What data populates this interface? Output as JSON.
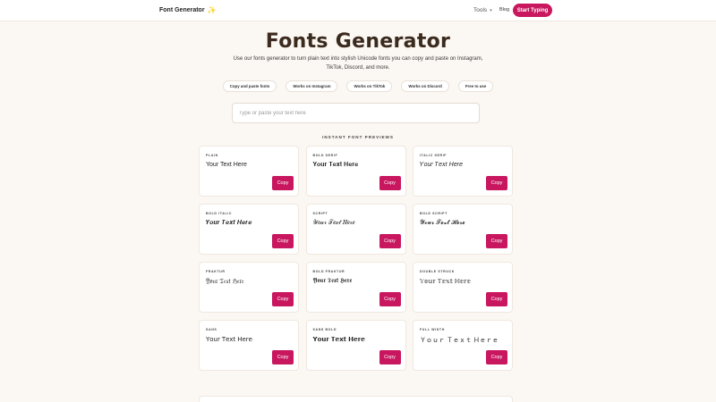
{
  "header": {
    "brand": "Font Generator",
    "brand_icon": "sparkle-icon",
    "nav_tools": "Tools",
    "nav_blog": "Blog",
    "cta": "Start Typing",
    "accent_color": "#c8175f"
  },
  "hero": {
    "title": "Fonts Generator",
    "subtitle": "Use our fonts generator to turn plain text into stylish Unicode fonts you can copy and paste on Instagram, TikTok, Discord, and more.",
    "features": [
      "Copy and paste fonts",
      "Works on Instagram",
      "Works on TikTok",
      "Works on Discord",
      "Free to use"
    ]
  },
  "search": {
    "placeholder": "Type or paste your text here",
    "value": ""
  },
  "previews": {
    "section_label": "INSTANT FONT PREVIEWS",
    "copy_label": "Copy",
    "cards": [
      {
        "label": "PLAIN",
        "sample": "Your Text Here"
      },
      {
        "label": "BOLD SERIF",
        "sample": "𝐘𝐨𝐮𝐫 𝐓𝐞𝐱𝐭 𝐇𝐞𝐫𝐞"
      },
      {
        "label": "ITALIC SERIF",
        "sample": "𝑌𝑜𝑢𝑟 𝑇𝑒𝑥𝑡 𝐻𝑒𝑟𝑒"
      },
      {
        "label": "BOLD ITALIC",
        "sample": "𝒀𝒐𝒖𝒓 𝑻𝒆𝒙𝒕 𝑯𝒆𝒓𝒆"
      },
      {
        "label": "SCRIPT",
        "sample": "𝒴𝑜𝓊𝓇 𝒯𝑒𝓍𝓉 𝐻𝑒𝓇𝑒"
      },
      {
        "label": "BOLD SCRIPT",
        "sample": "𝓨𝓸𝓾𝓻 𝓣𝓮𝔁𝓽 𝓗𝓮𝓻𝓮"
      },
      {
        "label": "FRAKTUR",
        "sample": "𝔜𝔬𝔲𝔯 𝔗𝔢𝔵𝔱 ℌ𝔢𝔯𝔢"
      },
      {
        "label": "BOLD FRAKTUR",
        "sample": "𝖄𝖔𝖚𝖗 𝕿𝖊𝖝𝖙 𝕳𝖊𝖗𝖊"
      },
      {
        "label": "DOUBLE STRUCK",
        "sample": "𝕐𝕠𝕦𝕣 𝕋𝕖𝕩𝕥 ℍ𝕖𝕣𝕖"
      },
      {
        "label": "SANS",
        "sample": "𝖸𝗈𝗎𝗋 𝖳𝖾𝗑𝗍 𝖧𝖾𝗋𝖾"
      },
      {
        "label": "SANS BOLD",
        "sample": "𝗬𝗼𝘂𝗿 𝗧𝗲𝘅𝘁 𝗛𝗲𝗿𝗲"
      },
      {
        "label": "FULL WIDTH",
        "sample": "Ｙｏｕｒ Ｔｅｘｔ Ｈｅｒｅ"
      }
    ]
  }
}
